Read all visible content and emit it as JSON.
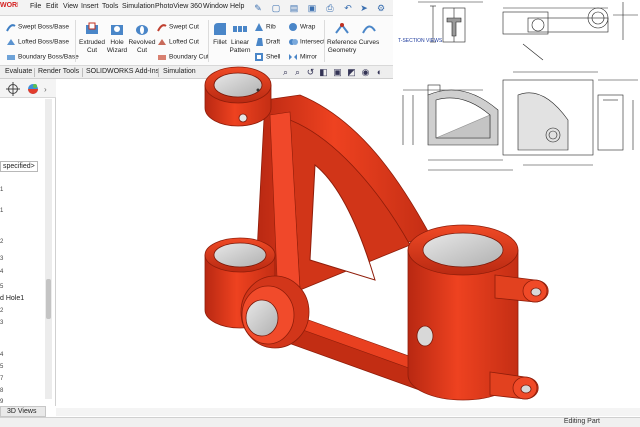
{
  "app": {
    "brand": "WORKS"
  },
  "menu": [
    "File",
    "Edit",
    "View",
    "Insert",
    "Tools",
    "Simulation",
    "PhotoView 360",
    "Window",
    "Help"
  ],
  "ribbon": {
    "swept_boss": "Swept Boss/Base",
    "lofted_boss": "Lofted Boss/Base",
    "boundary_boss": "Boundary Boss/Base",
    "extruded_cut": [
      "Extruded",
      "Cut"
    ],
    "hole_wizard": [
      "Hole",
      "Wizard"
    ],
    "revolved_cut": [
      "Revolved",
      "Cut"
    ],
    "swept_cut": "Swept Cut",
    "lofted_cut": "Lofted Cut",
    "boundary_cut": "Boundary Cut",
    "fillet": "Fillet",
    "linear_pattern": [
      "Linear",
      "Pattern"
    ],
    "rib": "Rib",
    "draft": "Draft",
    "shell": "Shell",
    "wrap": "Wrap",
    "intersect": "Intersect",
    "mirror": "Mirror",
    "reference_geometry": [
      "Reference",
      "Geometry"
    ],
    "curves": "Curves"
  },
  "tabs": [
    "Evaluate",
    "Render Tools",
    "SOLIDWORKS Add-Ins",
    "Simulation"
  ],
  "left_panel": {
    "specified": "specified>",
    "hole_label": "d Hole1",
    "tick_numbers": [
      "1",
      "1",
      "2",
      "3",
      "4",
      "5",
      "2",
      "3",
      "4",
      "5",
      "7",
      "8",
      "9"
    ]
  },
  "drawing": {
    "section_label": "T-SECTION VIEWS"
  },
  "bottom": {
    "tab": "3D Views",
    "status": "Editing Part"
  },
  "colors": {
    "part_red": "#e8391f",
    "part_dark": "#a8200e",
    "part_light": "#ff6a4a"
  }
}
